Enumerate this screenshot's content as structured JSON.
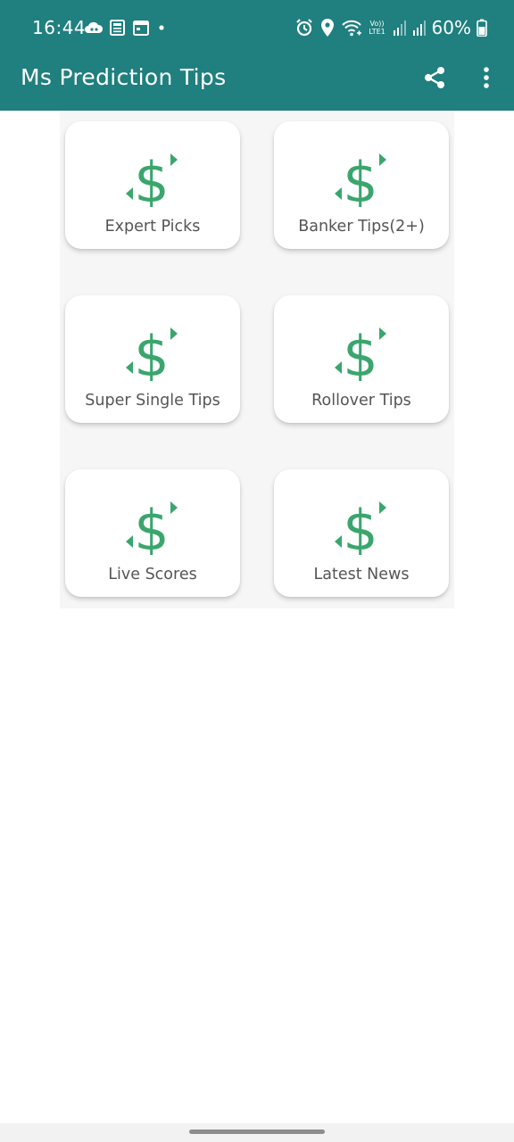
{
  "status_bar": {
    "time": "16:44",
    "battery": "60%",
    "left_icons": [
      "cloud-app-icon",
      "newspaper-icon",
      "calendar-icon",
      "dot-icon"
    ],
    "right_icons": [
      "alarm-icon",
      "location-icon",
      "wifi-calling-icon",
      "volte-icon",
      "signal-icon",
      "signal-icon",
      "battery-icon"
    ],
    "volte_label": "Vo)) LTE1"
  },
  "app_bar": {
    "title": "Ms Prediction Tips",
    "actions": [
      "share-icon",
      "more-vert-icon"
    ]
  },
  "menu": {
    "items": [
      {
        "label": "Expert Picks",
        "icon": "dollar-icon"
      },
      {
        "label": "Banker Tips(2+)",
        "icon": "dollar-icon"
      },
      {
        "label": "Super Single Tips",
        "icon": "dollar-icon"
      },
      {
        "label": "Rollover Tips",
        "icon": "dollar-icon"
      },
      {
        "label": "Live Scores",
        "icon": "dollar-icon"
      },
      {
        "label": "Latest News",
        "icon": "dollar-icon"
      }
    ]
  },
  "colors": {
    "primary": "#207f7f",
    "icon_green": "#3aa66d",
    "label_text": "#555555"
  }
}
